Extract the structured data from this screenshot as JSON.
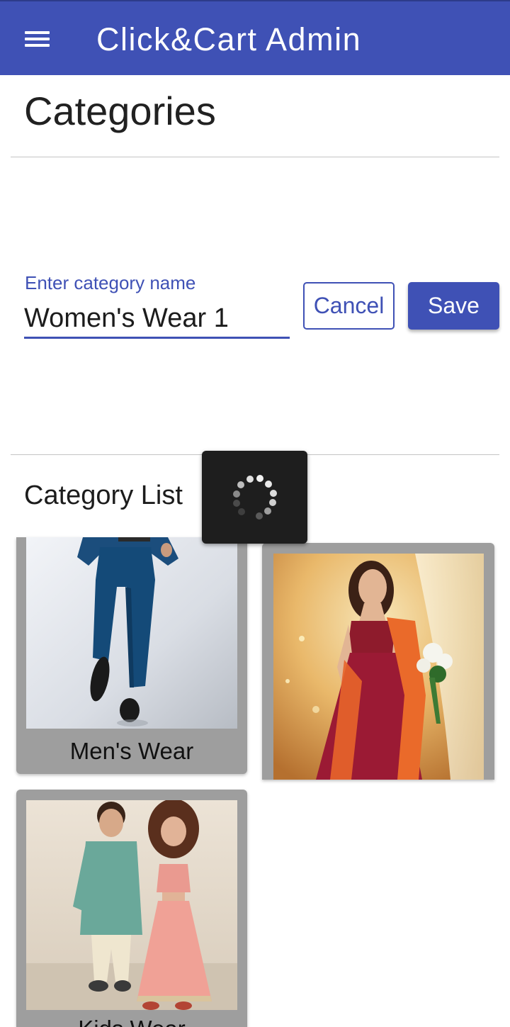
{
  "app_bar": {
    "title": "Click&Cart Admin",
    "menu_icon": "hamburger-menu-icon",
    "background": "#3f51b5"
  },
  "page": {
    "title": "Categories"
  },
  "form": {
    "label": "Enter category name",
    "value": "Women's Wear 1",
    "cancel_label": "Cancel",
    "save_label": "Save"
  },
  "list": {
    "title": "Category List",
    "items": [
      {
        "name": "Men's Wear",
        "image": "men-wear-photo"
      },
      {
        "name": "",
        "image": "women-wear-photo"
      },
      {
        "name": "Kids Wear",
        "image": "kids-wear-photo"
      }
    ]
  },
  "loader": {
    "icon": "loading-spinner-icon"
  },
  "colors": {
    "primary": "#3f51b5",
    "card_bg": "#9e9e9e",
    "loader_bg": "#1e1e1e"
  }
}
